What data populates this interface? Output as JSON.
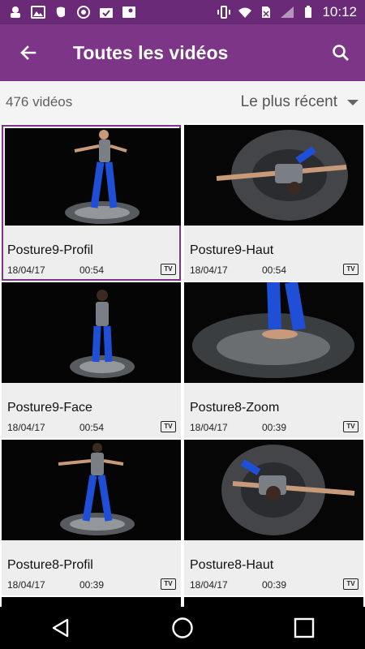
{
  "status_bar": {
    "time": "10:12",
    "left_icons": [
      "notification-icon",
      "image-icon",
      "evernote-icon",
      "dolphin-icon",
      "check-icon",
      "map-icon"
    ],
    "right_icons": [
      "vibrate-icon",
      "wifi-icon",
      "no-sim-icon",
      "signal-icon",
      "battery-icon"
    ]
  },
  "app_bar": {
    "title": "Toutes les vidéos",
    "back_icon": "arrow-left-icon",
    "search_icon": "search-icon"
  },
  "sub_header": {
    "count_text": "476 vidéos",
    "sort_label": "Le plus récent"
  },
  "videos": [
    {
      "title": "Posture9-Profil",
      "date": "18/04/17",
      "duration": "00:54",
      "badge": "TV",
      "selected": true
    },
    {
      "title": "Posture9-Haut",
      "date": "18/04/17",
      "duration": "00:54",
      "badge": "TV",
      "selected": false
    },
    {
      "title": "Posture9-Face",
      "date": "18/04/17",
      "duration": "00:54",
      "badge": "TV",
      "selected": false
    },
    {
      "title": "Posture8-Zoom",
      "date": "18/04/17",
      "duration": "00:39",
      "badge": "TV",
      "selected": false
    },
    {
      "title": "Posture8-Profil",
      "date": "18/04/17",
      "duration": "00:39",
      "badge": "TV",
      "selected": false
    },
    {
      "title": "Posture8-Haut",
      "date": "18/04/17",
      "duration": "00:39",
      "badge": "TV",
      "selected": false
    }
  ],
  "nav_bar": {
    "back_icon": "triangle-back-icon",
    "home_icon": "circle-home-icon",
    "recents_icon": "square-recents-icon"
  },
  "colors": {
    "status_bar": "#6b2a78",
    "app_bar": "#7c3587",
    "selection": "#7c3587",
    "card_bg": "#eeeeee"
  }
}
